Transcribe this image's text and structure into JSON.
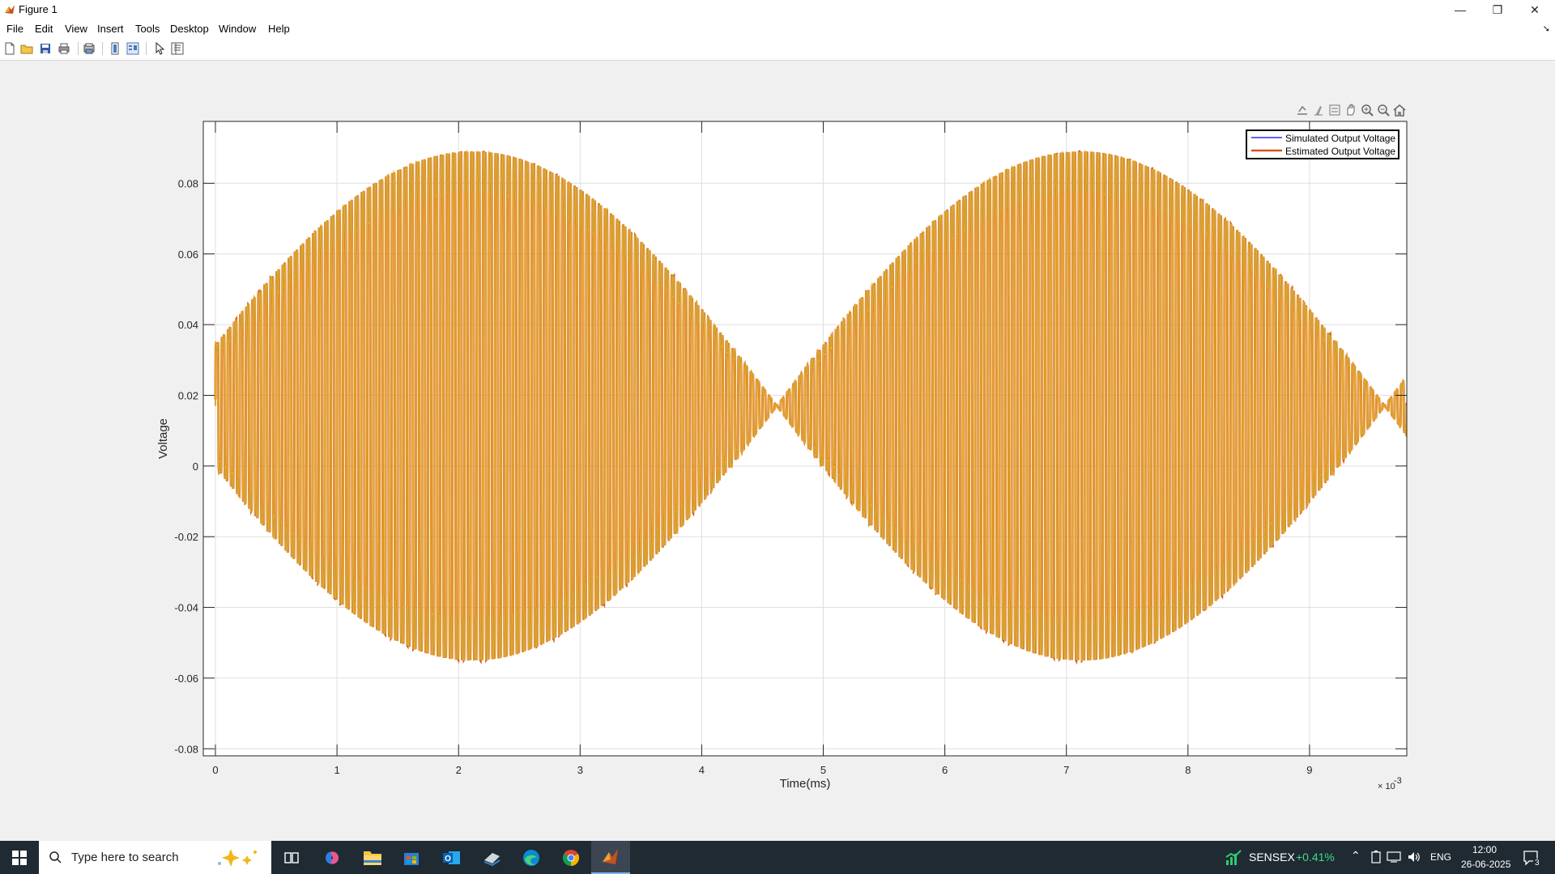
{
  "window": {
    "title": "Figure 1",
    "minimize": "—",
    "restore": "❐",
    "close": "✕"
  },
  "menu": [
    "File",
    "Edit",
    "View",
    "Insert",
    "Tools",
    "Desktop",
    "Window",
    "Help"
  ],
  "toolbar_icons": [
    "new-figure-icon",
    "open-file-icon",
    "save-icon",
    "print-icon",
    "print-preview-icon",
    "link-plot-icon",
    "insert-colorbar-icon",
    "edit-plot-icon",
    "property-inspector-icon"
  ],
  "axes_toolbar_icons": [
    "export-icon",
    "brush-icon",
    "datatip-icon",
    "pan-icon",
    "zoom-in-icon",
    "zoom-out-icon",
    "home-icon"
  ],
  "colors": {
    "simulated": "#0000ff",
    "estimated": "#d95319",
    "trace_overlap": "#edb120"
  },
  "chart_data": {
    "type": "line",
    "title": "",
    "xlabel": "Time(ms)",
    "ylabel": "Voltage",
    "x_exponent_label": "× 10",
    "x_exponent": "-3",
    "xlim": [
      -0.0001,
      0.0098
    ],
    "ylim": [
      -0.082,
      0.0975
    ],
    "x_ticks": [
      0,
      0.001,
      0.002,
      0.003,
      0.004,
      0.005,
      0.006,
      0.007,
      0.008,
      0.009
    ],
    "x_tick_labels": [
      "0",
      "1",
      "2",
      "3",
      "4",
      "5",
      "6",
      "7",
      "8",
      "9"
    ],
    "y_ticks": [
      -0.08,
      -0.06,
      -0.04,
      -0.02,
      0,
      0.02,
      0.04,
      0.06,
      0.08
    ],
    "y_tick_labels": [
      "-0.08",
      "-0.06",
      "-0.04",
      "-0.02",
      "0",
      "0.02",
      "0.04",
      "0.06",
      "0.08"
    ],
    "grid": true,
    "legend_position": "top-right",
    "signal_model": {
      "offset": 0.017,
      "envelope_amplitude": 0.078,
      "envelope_period": 0.005,
      "carrier_frequency": 20000,
      "ripple_amplitude": 0.006,
      "ripple_frequency": 60000,
      "duration": 0.0098
    },
    "series": [
      {
        "name": "Simulated Output Voltage",
        "color": "#0000ff"
      },
      {
        "name": "Estimated Output Voltage",
        "color": "#d95319"
      }
    ]
  },
  "taskbar": {
    "search_placeholder": "Type here to search",
    "apps": [
      "task-view-icon",
      "copilot-icon",
      "file-explorer-icon",
      "store-icon",
      "outlook-icon",
      "onedrive-icon",
      "edge-icon",
      "chrome-icon",
      "matlab-icon"
    ],
    "sensex_label": "SENSEX",
    "sensex_change": "+0.41%",
    "language": "ENG",
    "time": "12:00",
    "date": "26-06-2025",
    "notification_count": "3"
  }
}
